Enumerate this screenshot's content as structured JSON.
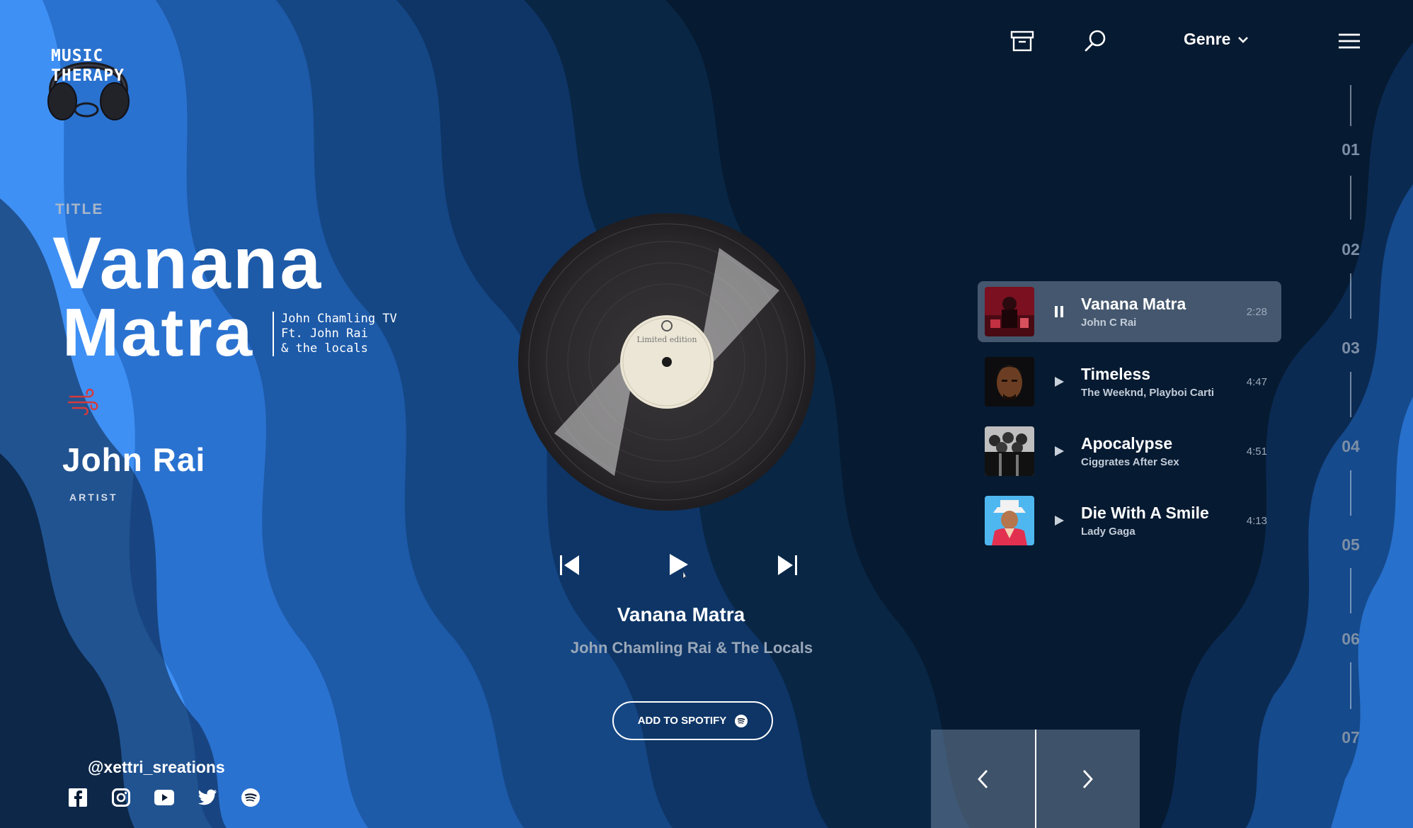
{
  "brand": {
    "logo_line1": "MUSIC",
    "logo_line2": "THERAPY"
  },
  "header": {
    "genre_label": "Genre",
    "icons": [
      "archive-icon",
      "search-icon",
      "chevron-down-icon",
      "menu-icon"
    ]
  },
  "hero": {
    "section_label": "TITLE",
    "title_line1": "Vanana",
    "title_line2": "Matra",
    "credits": [
      "John Chamling TV",
      "Ft. John Rai",
      "& the locals"
    ],
    "artist_name": "John Rai",
    "artist_label": "ARTIST"
  },
  "player": {
    "record_label_text": "Limited edition",
    "now_playing_title": "Vanana Matra",
    "now_playing_artist": "John Chamling Rai & The Locals",
    "spotify_button": "ADD TO SPOTIFY"
  },
  "footer": {
    "handle": "@xettri_sreations",
    "socials": [
      "facebook-icon",
      "instagram-icon",
      "youtube-icon",
      "twitter-icon",
      "spotify-icon"
    ]
  },
  "playlist": [
    {
      "title": "Vanana Matra",
      "artist": "John C Rai",
      "duration": "2:28",
      "state": "playing"
    },
    {
      "title": "Timeless",
      "artist": "The Weeknd, Playboi Carti",
      "duration": "4:47",
      "state": "paused"
    },
    {
      "title": "Apocalypse",
      "artist": "Ciggrates After Sex",
      "duration": "4:51",
      "state": "paused"
    },
    {
      "title": "Die With A Smile",
      "artist": "Lady Gaga",
      "duration": "4:13",
      "state": "paused"
    }
  ],
  "page_numbers": [
    "01",
    "02",
    "03",
    "04",
    "05",
    "06",
    "07"
  ],
  "colors": {
    "accent_red": "#d43a3a",
    "bg_dark": "#061426",
    "bg_light": "#2f86ee"
  }
}
